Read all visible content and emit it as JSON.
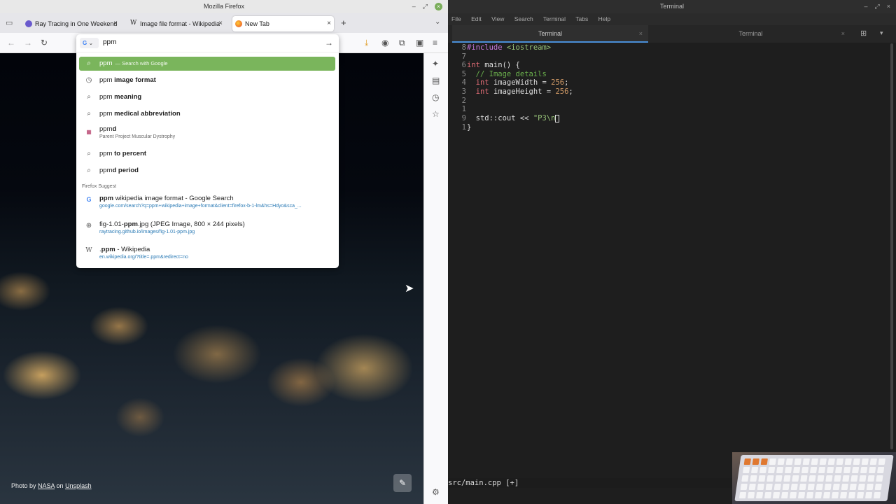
{
  "firefox": {
    "window_title": "Mozilla Firefox",
    "tabs": [
      {
        "label": "Ray Tracing in One Weekend",
        "icon": "raytracing-favicon",
        "active": false
      },
      {
        "label": "Image file format - Wikipedia",
        "icon": "wikipedia-favicon",
        "active": false
      },
      {
        "label": "New Tab",
        "icon": "firefox-favicon",
        "active": true
      }
    ],
    "url_input": "ppm",
    "selected_suggestion": {
      "term": "ppm",
      "hint": "— Search with Google"
    },
    "search_suggestions": [
      {
        "prefix": "ppm",
        "bold": " image format",
        "icon": "history-icon"
      },
      {
        "prefix": "ppm",
        "bold": " meaning",
        "icon": "search-icon"
      },
      {
        "prefix": "ppm",
        "bold": " medical abbreviation",
        "icon": "search-icon"
      }
    ],
    "ppmd": {
      "title_prefix": "ppm",
      "title_bold": "d",
      "subtitle": "Parent Project Muscular Dystrophy"
    },
    "more_suggestions": [
      {
        "prefix": "ppm",
        "bold": " to percent",
        "icon": "search-icon"
      },
      {
        "prefix": "ppm",
        "bold": "d period",
        "icon": "search-icon"
      }
    ],
    "firefox_suggest_header": "Firefox Suggest",
    "suggest_items": [
      {
        "bold": "ppm",
        "title_rest": " wikipedia image format - Google Search",
        "url": "google.com/search?q=ppm+wikipedia+image+format&client=firefox-b-1-lm&hs=Hdyo&sca_...",
        "icon": "google-icon"
      },
      {
        "pre": "fig-1.01-",
        "bold": "ppm",
        "title_rest": ".jpg (JPEG Image, 800 × 244 pixels)",
        "url": "raytracing.github.io/images/fig-1.01-ppm.jpg",
        "icon": "globe-icon"
      },
      {
        "pre": ".",
        "bold": "ppm",
        "title_rest": " - Wikipedia",
        "url": "en.wikipedia.org/?title=.ppm&redirect=no",
        "icon": "wikipedia-icon"
      }
    ],
    "photo_credit": {
      "prefix": "Photo by ",
      "author": "NASA",
      "mid": " on ",
      "site": "Unsplash"
    }
  },
  "terminal": {
    "window_title": "Terminal",
    "menu": [
      "File",
      "Edit",
      "View",
      "Search",
      "Terminal",
      "Tabs",
      "Help"
    ],
    "tabs": [
      "Terminal",
      "Terminal"
    ],
    "code_lines": [
      {
        "ln": "8",
        "code": "#include <iostream>"
      },
      {
        "ln": "7",
        "code": ""
      },
      {
        "ln": "6",
        "code": "int main() {"
      },
      {
        "ln": "5",
        "code": "  // Image details"
      },
      {
        "ln": "4",
        "code": "  int imageWidth = 256;"
      },
      {
        "ln": "3",
        "code": "  int imageHeight = 256;"
      },
      {
        "ln": "2",
        "code": ""
      },
      {
        "ln": "1",
        "code": ""
      },
      {
        "ln": "9",
        "code": "  std::cout << \"P3\\n\""
      },
      {
        "ln": "1",
        "code": "}"
      }
    ],
    "status_line": "src/main.cpp [+]"
  },
  "colors": {
    "selected_row": "#7ab55c",
    "terminal_bg": "#1e1e1e",
    "link_blue": "#2a7ab5"
  }
}
